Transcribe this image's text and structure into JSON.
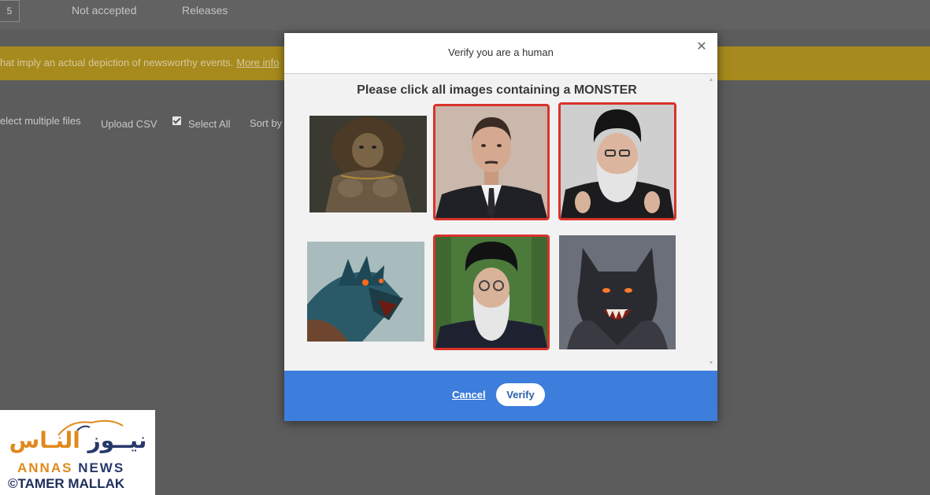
{
  "background": {
    "page_number": "5",
    "tabs": [
      "Not accepted",
      "Releases"
    ],
    "banner_text": "hat imply an actual depiction of newsworthy events.",
    "banner_link": "More info",
    "toolbar": {
      "select_multiple": "elect multiple files",
      "upload_csv": "Upload CSV",
      "select_all": "Select All",
      "sort_by": "Sort by"
    }
  },
  "modal": {
    "title": "Verify you are a human",
    "close_icon": "close-icon",
    "instruction": "Please click all images containing a MONSTER",
    "tiles": [
      {
        "subject": "lion-beast-monster",
        "selected": false
      },
      {
        "subject": "man-in-suit-portrait",
        "selected": true
      },
      {
        "subject": "bearded-man-black-turban-portrait",
        "selected": true
      },
      {
        "subject": "blue-dragon-monster",
        "selected": false
      },
      {
        "subject": "elderly-bearded-man-black-turban-portrait",
        "selected": true
      },
      {
        "subject": "werewolf-monster",
        "selected": false
      }
    ],
    "cancel_label": "Cancel",
    "verify_label": "Verify",
    "colors": {
      "footer": "#3d7ddb",
      "selection_border": "#d9322b"
    }
  },
  "watermark": {
    "arabic_part1": "نيــوز",
    "arabic_part2": "النـاس",
    "english_part1": "ANNAS",
    "english_part2": "NEWS",
    "credit": "©TAMER MALLAK"
  }
}
